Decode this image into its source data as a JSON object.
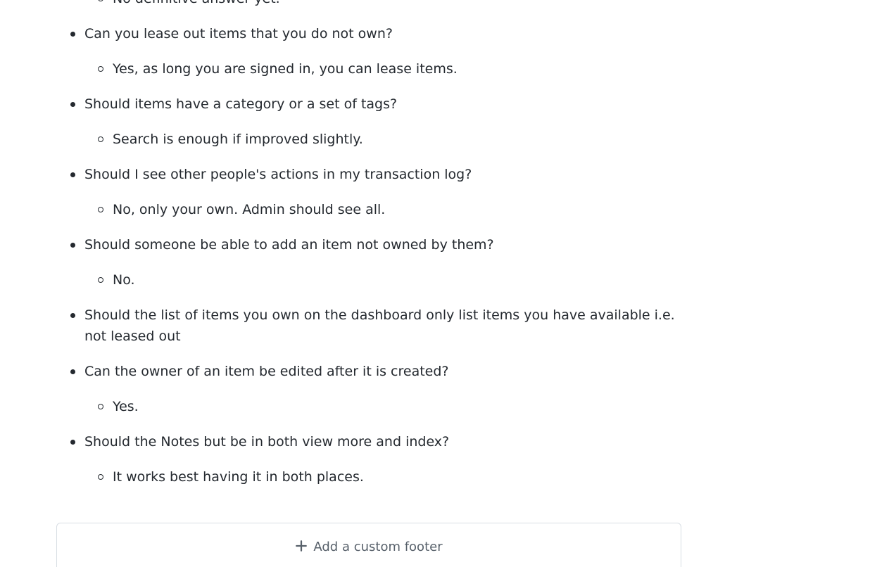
{
  "faq": {
    "items": [
      {
        "question": "",
        "answer": "No definitive answer yet."
      },
      {
        "question": "Can you lease out items that you do not own?",
        "answer": "Yes, as long you are signed in, you can lease items."
      },
      {
        "question": "Should items have a category or a set of tags?",
        "answer": "Search is enough if improved slightly."
      },
      {
        "question": "Should I see other people's actions in my transaction log?",
        "answer": "No, only your own. Admin should see all."
      },
      {
        "question": "Should someone be able to add an item not owned by them?",
        "answer": "No."
      },
      {
        "question": "Should the list of items you own on the dashboard only list items you have available i.e. not leased out",
        "answer": ""
      },
      {
        "question": "Can the owner of an item be edited after it is created?",
        "answer": "Yes."
      },
      {
        "question": "Should the Notes but be in both view more and index?",
        "answer": "It works best having it in both places."
      }
    ]
  },
  "footer": {
    "add_label": "Add a custom footer",
    "icon": "plus-icon"
  }
}
